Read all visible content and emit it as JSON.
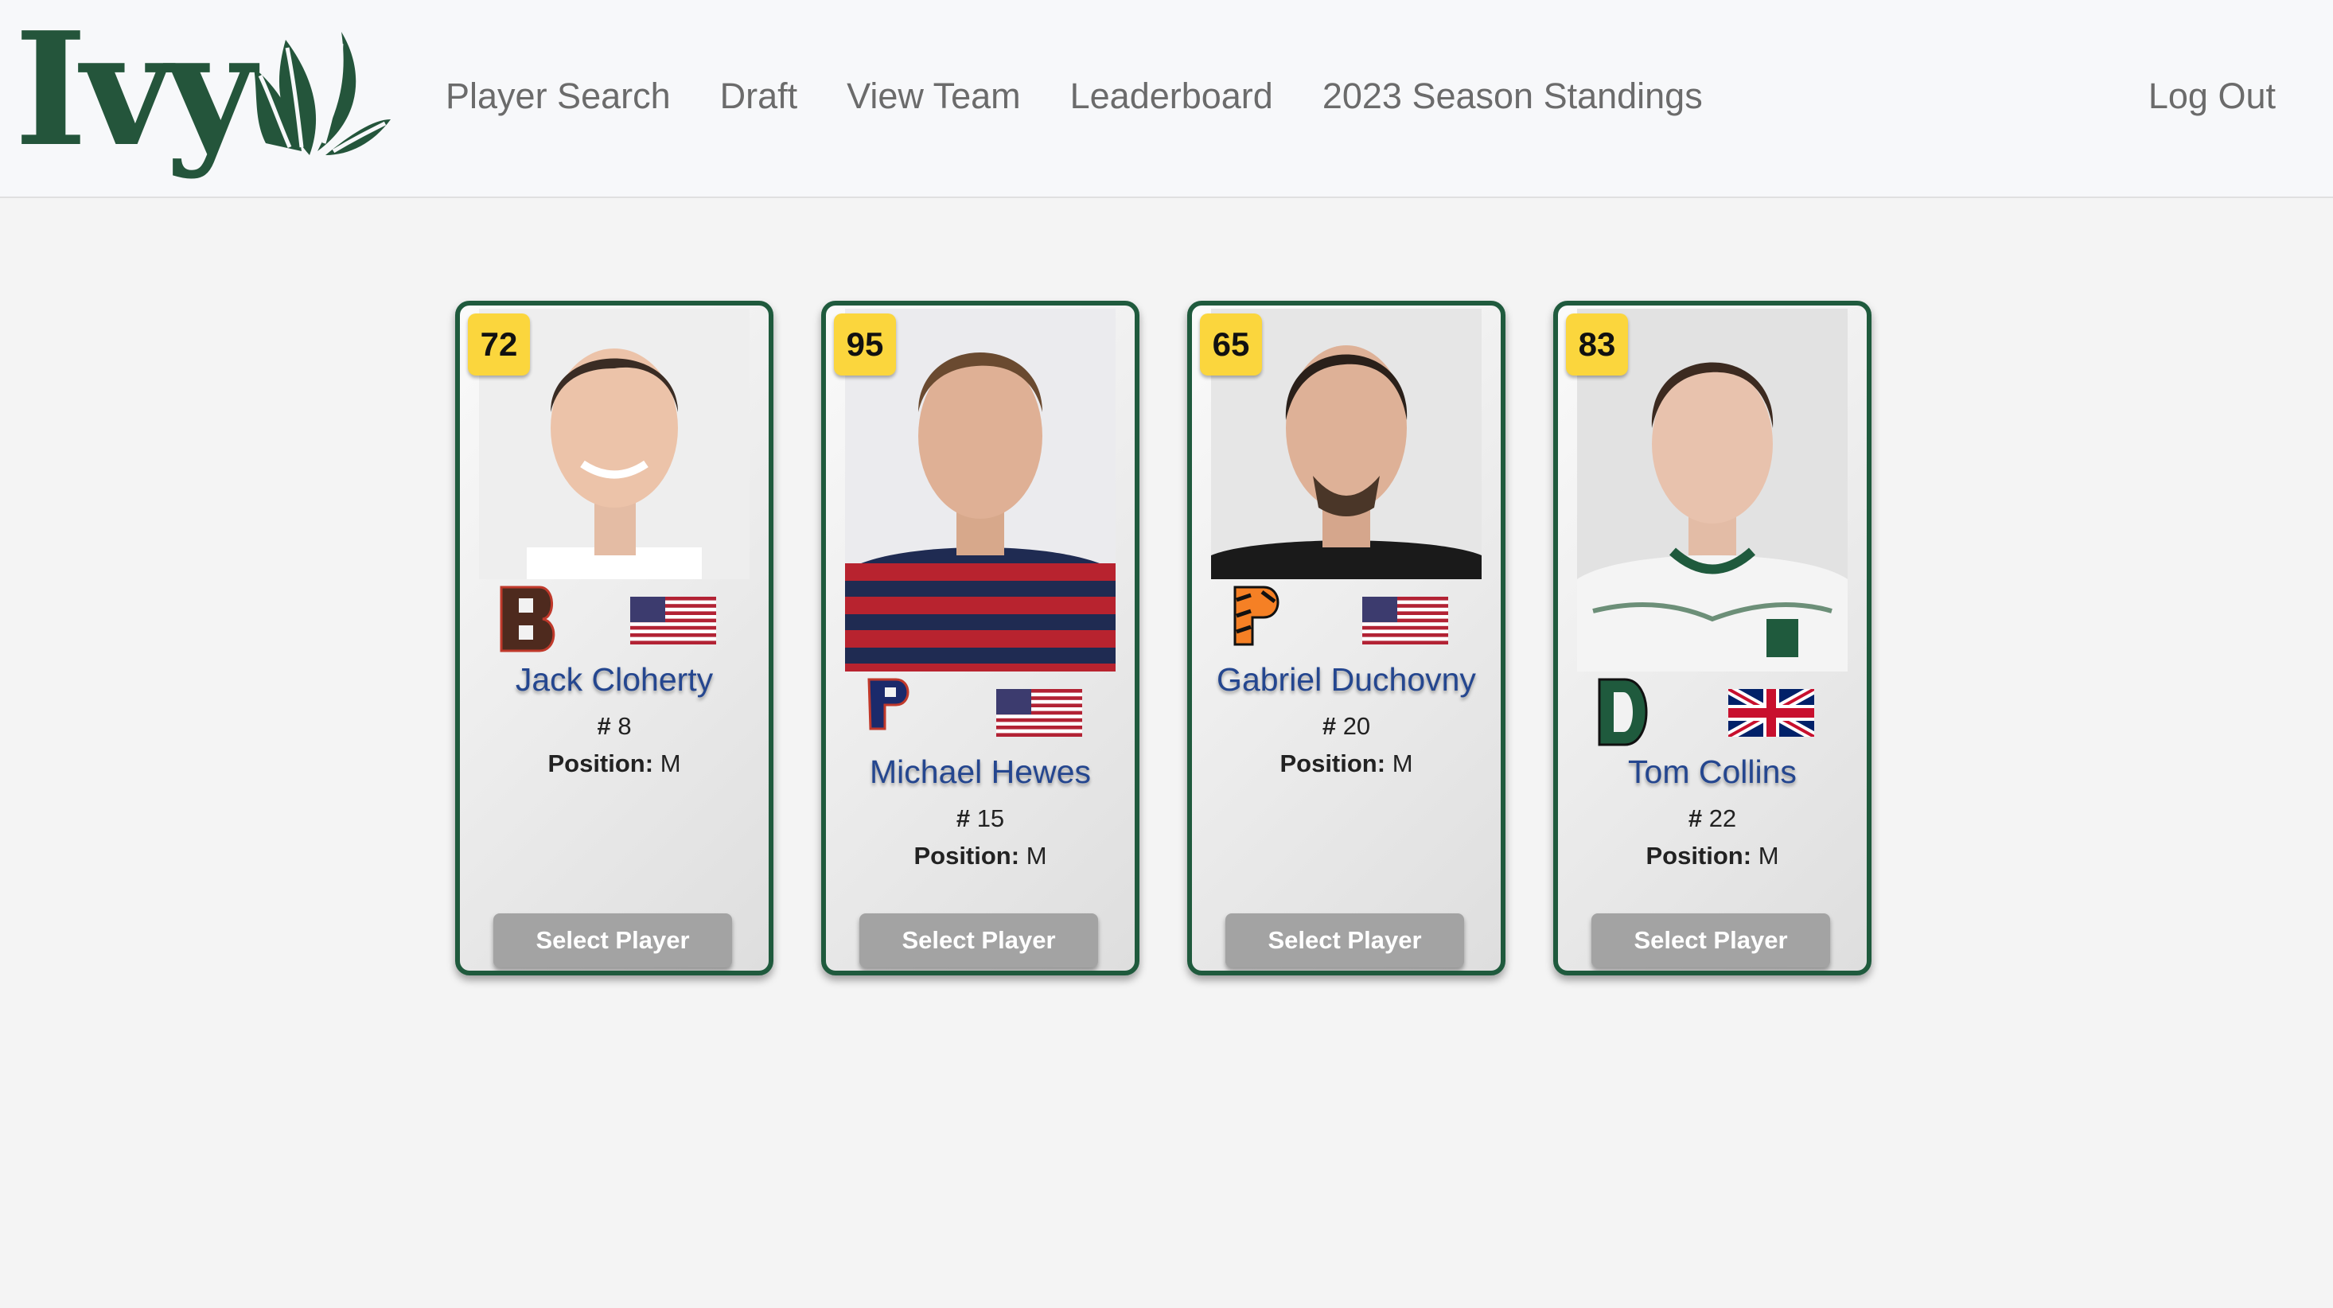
{
  "logo": {
    "text": "Ivy",
    "icon": "leaf-icon"
  },
  "nav": {
    "items": [
      {
        "label": "Player Search"
      },
      {
        "label": "Draft"
      },
      {
        "label": "View Team"
      },
      {
        "label": "Leaderboard"
      },
      {
        "label": "2023 Season Standings"
      }
    ],
    "logout_label": "Log Out"
  },
  "cards": [
    {
      "rating": "72",
      "name": "Jack Cloherty",
      "number_label": "#",
      "number": "8",
      "position_label": "Position:",
      "position": "M",
      "school_icon": "brown-b-logo",
      "flag_icon": "usa-flag-icon",
      "button_label": "Select Player"
    },
    {
      "rating": "95",
      "name": "Michael Hewes",
      "number_label": "#",
      "number": "15",
      "position_label": "Position:",
      "position": "M",
      "school_icon": "penn-p-logo",
      "flag_icon": "usa-flag-icon",
      "button_label": "Select Player"
    },
    {
      "rating": "65",
      "name": "Gabriel Duchovny",
      "number_label": "#",
      "number": "20",
      "position_label": "Position:",
      "position": "M",
      "school_icon": "princeton-p-logo",
      "flag_icon": "usa-flag-icon",
      "button_label": "Select Player"
    },
    {
      "rating": "83",
      "name": "Tom Collins",
      "number_label": "#",
      "number": "22",
      "position_label": "Position:",
      "position": "M",
      "school_icon": "dartmouth-d-logo",
      "flag_icon": "uk-flag-icon",
      "button_label": "Select Player"
    }
  ],
  "colors": {
    "brand_green": "#24553b",
    "card_border": "#1f5a3d",
    "rating_bg": "#fbd63d",
    "name_blue": "#24468f",
    "button_gray": "#a3a3a3"
  }
}
